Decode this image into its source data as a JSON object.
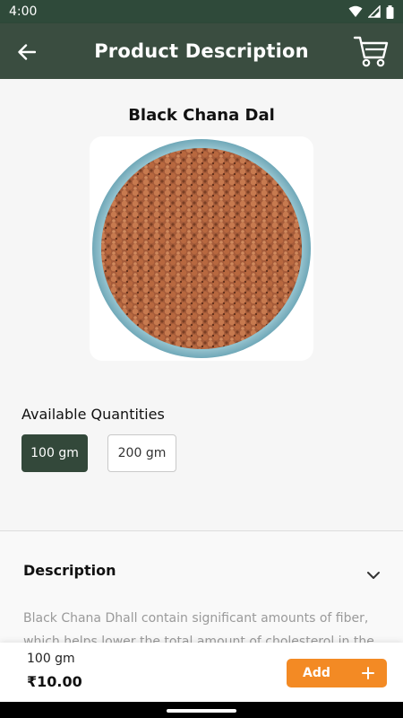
{
  "status_bar": {
    "time": "4:00"
  },
  "app_bar": {
    "title": "Product Description"
  },
  "product": {
    "name": "Black Chana Dal"
  },
  "quantities": {
    "title": "Available Quantities",
    "options": [
      "100 gm",
      "200 gm"
    ],
    "selected": "100 gm"
  },
  "description": {
    "title": "Description",
    "text": "Black Chana Dhall contain significant amounts of fiber, which helps lower the total amount of cholesterol in the"
  },
  "cart_bar": {
    "quantity": "100 gm",
    "price": "₹10.00",
    "add_label": "Add"
  },
  "colors": {
    "header": "#3a4d40",
    "selected_chip": "#33483a",
    "add_button": "#f38a24"
  },
  "icons": [
    "back-arrow-icon",
    "cart-icon",
    "chevron-down-icon",
    "plus-icon",
    "wifi-icon",
    "signal-icon",
    "battery-icon"
  ]
}
